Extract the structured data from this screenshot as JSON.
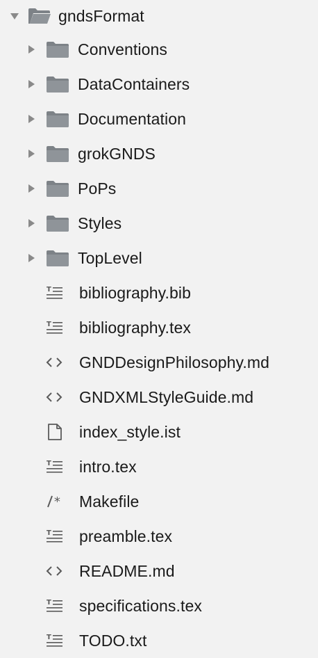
{
  "root": {
    "label": "gndsFormat",
    "icon": "folder-open-icon",
    "expanded": true
  },
  "folders": [
    {
      "label": "Conventions",
      "icon": "folder-icon"
    },
    {
      "label": "DataContainers",
      "icon": "folder-icon"
    },
    {
      "label": "Documentation",
      "icon": "folder-icon"
    },
    {
      "label": "grokGNDS",
      "icon": "folder-icon"
    },
    {
      "label": "PoPs",
      "icon": "folder-icon"
    },
    {
      "label": "Styles",
      "icon": "folder-icon"
    },
    {
      "label": "TopLevel",
      "icon": "folder-icon"
    }
  ],
  "files": [
    {
      "label": "bibliography.bib",
      "icon": "text-lines-icon"
    },
    {
      "label": "bibliography.tex",
      "icon": "text-lines-icon"
    },
    {
      "label": "GNDDesignPhilosophy.md",
      "icon": "angle-brackets-icon"
    },
    {
      "label": "GNDXMLStyleGuide.md",
      "icon": "angle-brackets-icon"
    },
    {
      "label": "index_style.ist",
      "icon": "document-icon"
    },
    {
      "label": "intro.tex",
      "icon": "text-lines-icon"
    },
    {
      "label": "Makefile",
      "icon": "comment-slash-icon"
    },
    {
      "label": "preamble.tex",
      "icon": "text-lines-icon"
    },
    {
      "label": "README.md",
      "icon": "angle-brackets-icon"
    },
    {
      "label": "specifications.tex",
      "icon": "text-lines-icon"
    },
    {
      "label": "TODO.txt",
      "icon": "text-lines-icon"
    }
  ],
  "colors": {
    "background": "#f2f2f2",
    "folder": "#8f9499",
    "folder_tab": "#7d8287",
    "icon_glyph": "#5a5a5a",
    "text": "#1a1a1a",
    "disclosure": "#8a8a8a"
  }
}
